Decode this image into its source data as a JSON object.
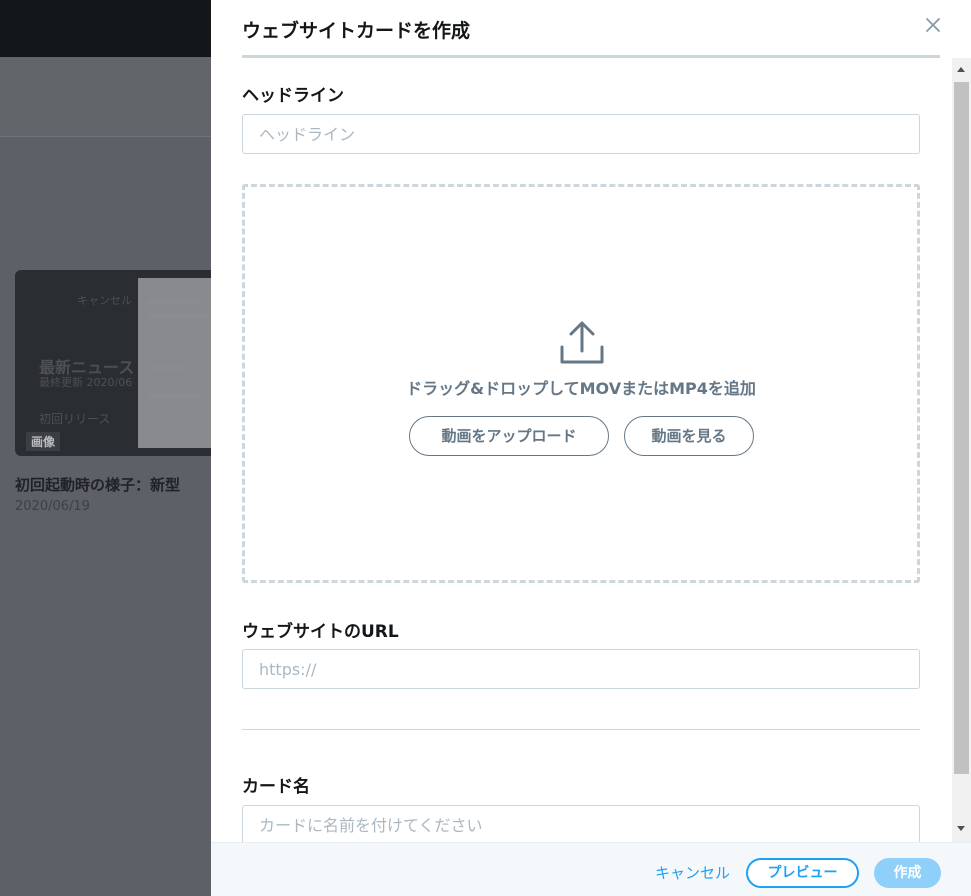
{
  "background": {
    "thumb_menu_text": "キャンセル",
    "thumb_title": "最新ニュース",
    "thumb_subtitle": "最終更新 2020/06",
    "thumb_footer": "初回リリース",
    "badge": "画像",
    "item_title": "初回起動時の様子：新型",
    "item_date": "2020/06/19"
  },
  "modal": {
    "title": "ウェブサイトカードを作成",
    "close_icon": "close-icon",
    "headline": {
      "label": "ヘッドライン",
      "placeholder": "ヘッドライン",
      "value": ""
    },
    "dropzone": {
      "icon": "upload-icon",
      "text": "ドラッグ&ドロップしてMOVまたはMP4を追加",
      "upload_label": "動画をアップロード",
      "view_label": "動画を見る"
    },
    "website_url": {
      "label": "ウェブサイトのURL",
      "placeholder": "https://",
      "value": ""
    },
    "card_name": {
      "label": "カード名",
      "placeholder": "カードに名前を付けてください",
      "value": ""
    },
    "footer": {
      "cancel_label": "キャンセル",
      "preview_label": "プレビュー",
      "create_label": "作成"
    }
  },
  "colors": {
    "accent": "#1da1f2",
    "accent_disabled": "#8ed0f9",
    "text_secondary": "#657786",
    "border": "#ccd6dd"
  }
}
